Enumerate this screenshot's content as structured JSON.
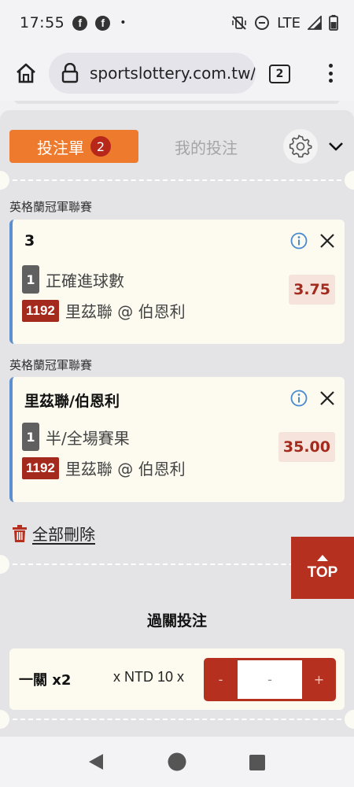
{
  "status_bar": {
    "time": "17:55",
    "network": "LTE",
    "icons": [
      "facebook-icon",
      "facebook-icon",
      "dot-icon",
      "vibrate-off-icon",
      "do-not-disturb-icon",
      "signal-icon",
      "battery-icon"
    ]
  },
  "browser": {
    "url": "sportslottery.com.tw/",
    "tab_count": "2"
  },
  "betslip": {
    "tab_active_label": "投注單",
    "tab_active_count": "2",
    "tab_inactive_label": "我的投注",
    "bets": [
      {
        "league": "英格蘭冠軍聯賽",
        "selection": "3",
        "bet_type_num": "1",
        "bet_type": "正確進球數",
        "game_code": "1192",
        "teams": "里茲聯 @ 伯恩利",
        "odds": "3.75"
      },
      {
        "league": "英格蘭冠軍聯賽",
        "selection": "里茲聯/伯恩利",
        "bet_type_num": "1",
        "bet_type": "半/全場賽果",
        "game_code": "1192",
        "teams": "里茲聯 @ 伯恩利",
        "odds": "35.00"
      }
    ],
    "delete_all_label": "全部刪除",
    "top_label": "TOP",
    "parlay": {
      "title": "過關投注",
      "combo": "一關 x2",
      "unit": "x NTD 10 x",
      "minus_label": "-",
      "amount": "-",
      "plus_label": "+"
    }
  },
  "colors": {
    "accent_orange": "#ee7a2d",
    "brand_red": "#b5301f",
    "card_bg": "#fdfbf0",
    "card_border": "#5b8fd0",
    "info_blue": "#4a8ad0"
  }
}
